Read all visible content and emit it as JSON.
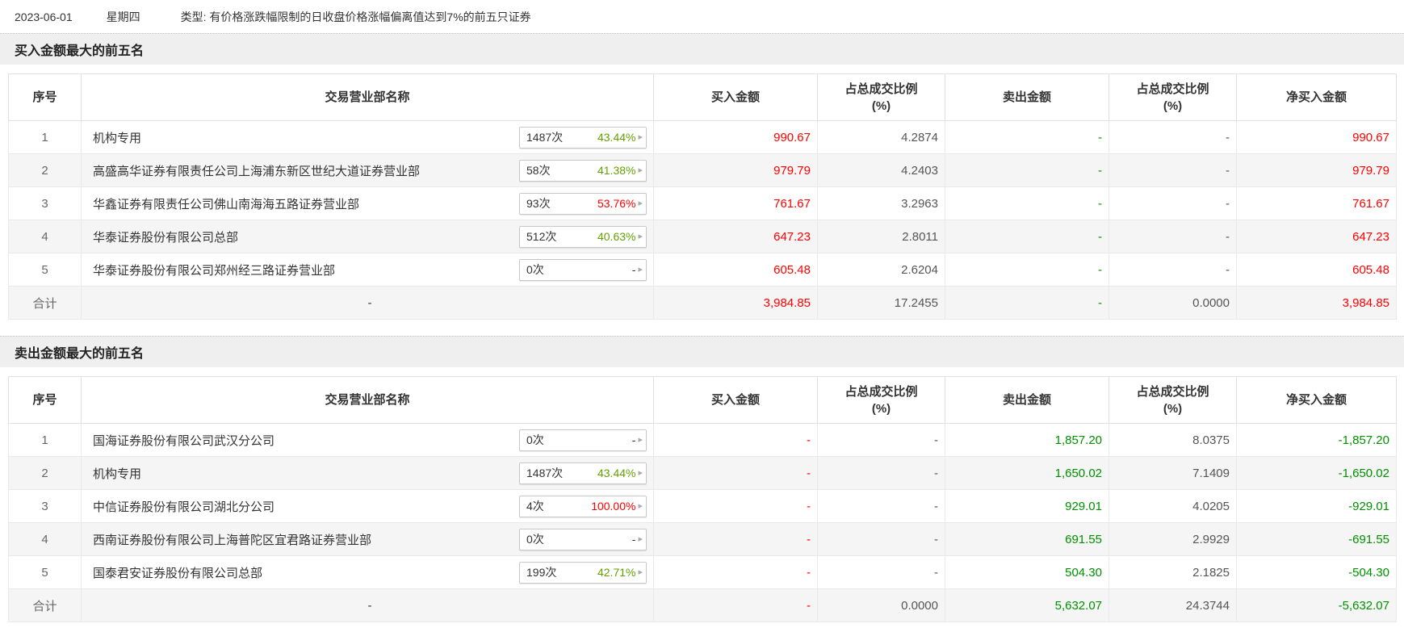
{
  "topbar": {
    "date": "2023-06-01",
    "weekday": "星期四",
    "type": "类型: 有价格涨跌幅限制的日收盘价格涨幅偏离值达到7%的前五只证券"
  },
  "colors": {
    "red": "#ff0000",
    "green": "#009000",
    "badge_green": "#63a103",
    "badge_red": "#ff0000",
    "pct": "#555555",
    "dark": "#333333"
  },
  "sections": [
    {
      "title": "买入金额最大的前五名",
      "columns": [
        {
          "label": "序号"
        },
        {
          "label": "交易营业部名称"
        },
        {
          "label": "买入金额"
        },
        {
          "label": "占总成交比例",
          "sub": "(%)"
        },
        {
          "label": "卖出金额"
        },
        {
          "label": "占总成交比例",
          "sub": "(%)"
        },
        {
          "label": "净买入金额"
        }
      ],
      "rows": [
        {
          "no": "1",
          "name": "机构专用",
          "badge": {
            "count": "1487次",
            "pct": "43.44%",
            "pct_color": "badge_green"
          },
          "buy": {
            "v": "990.67",
            "c": "red"
          },
          "buy_pct": {
            "v": "4.2874",
            "c": "pct"
          },
          "sell": {
            "v": "-",
            "c": "green"
          },
          "sell_pct": {
            "v": "-",
            "c": "pct"
          },
          "net": {
            "v": "990.67",
            "c": "red"
          }
        },
        {
          "no": "2",
          "name": "高盛高华证券有限责任公司上海浦东新区世纪大道证券营业部",
          "badge": {
            "count": "58次",
            "pct": "41.38%",
            "pct_color": "badge_green"
          },
          "buy": {
            "v": "979.79",
            "c": "red"
          },
          "buy_pct": {
            "v": "4.2403",
            "c": "pct"
          },
          "sell": {
            "v": "-",
            "c": "green"
          },
          "sell_pct": {
            "v": "-",
            "c": "pct"
          },
          "net": {
            "v": "979.79",
            "c": "red"
          }
        },
        {
          "no": "3",
          "name": "华鑫证券有限责任公司佛山南海海五路证券营业部",
          "badge": {
            "count": "93次",
            "pct": "53.76%",
            "pct_color": "badge_red"
          },
          "buy": {
            "v": "761.67",
            "c": "red"
          },
          "buy_pct": {
            "v": "3.2963",
            "c": "pct"
          },
          "sell": {
            "v": "-",
            "c": "green"
          },
          "sell_pct": {
            "v": "-",
            "c": "pct"
          },
          "net": {
            "v": "761.67",
            "c": "red"
          }
        },
        {
          "no": "4",
          "name": "华泰证券股份有限公司总部",
          "badge": {
            "count": "512次",
            "pct": "40.63%",
            "pct_color": "badge_green"
          },
          "buy": {
            "v": "647.23",
            "c": "red"
          },
          "buy_pct": {
            "v": "2.8011",
            "c": "pct"
          },
          "sell": {
            "v": "-",
            "c": "green"
          },
          "sell_pct": {
            "v": "-",
            "c": "pct"
          },
          "net": {
            "v": "647.23",
            "c": "red"
          }
        },
        {
          "no": "5",
          "name": "华泰证券股份有限公司郑州经三路证券营业部",
          "badge": {
            "count": "0次",
            "pct": "-",
            "pct_color": "dark"
          },
          "buy": {
            "v": "605.48",
            "c": "red"
          },
          "buy_pct": {
            "v": "2.6204",
            "c": "pct"
          },
          "sell": {
            "v": "-",
            "c": "green"
          },
          "sell_pct": {
            "v": "-",
            "c": "pct"
          },
          "net": {
            "v": "605.48",
            "c": "red"
          }
        }
      ],
      "total_row": {
        "no": "合计",
        "name": "-",
        "badge": null,
        "buy": {
          "v": "3,984.85",
          "c": "red"
        },
        "buy_pct": {
          "v": "17.2455",
          "c": "pct"
        },
        "sell": {
          "v": "-",
          "c": "green"
        },
        "sell_pct": {
          "v": "0.0000",
          "c": "pct"
        },
        "net": {
          "v": "3,984.85",
          "c": "red"
        }
      }
    },
    {
      "title": "卖出金额最大的前五名",
      "columns": [
        {
          "label": "序号"
        },
        {
          "label": "交易营业部名称"
        },
        {
          "label": "买入金额"
        },
        {
          "label": "占总成交比例",
          "sub": "(%)"
        },
        {
          "label": "卖出金额"
        },
        {
          "label": "占总成交比例",
          "sub": "(%)"
        },
        {
          "label": "净买入金额"
        }
      ],
      "rows": [
        {
          "no": "1",
          "name": "国海证券股份有限公司武汉分公司",
          "badge": {
            "count": "0次",
            "pct": "-",
            "pct_color": "dark"
          },
          "buy": {
            "v": "-",
            "c": "red"
          },
          "buy_pct": {
            "v": "-",
            "c": "pct"
          },
          "sell": {
            "v": "1,857.20",
            "c": "green"
          },
          "sell_pct": {
            "v": "8.0375",
            "c": "pct"
          },
          "net": {
            "v": "-1,857.20",
            "c": "green"
          }
        },
        {
          "no": "2",
          "name": "机构专用",
          "badge": {
            "count": "1487次",
            "pct": "43.44%",
            "pct_color": "badge_green"
          },
          "buy": {
            "v": "-",
            "c": "red"
          },
          "buy_pct": {
            "v": "-",
            "c": "pct"
          },
          "sell": {
            "v": "1,650.02",
            "c": "green"
          },
          "sell_pct": {
            "v": "7.1409",
            "c": "pct"
          },
          "net": {
            "v": "-1,650.02",
            "c": "green"
          }
        },
        {
          "no": "3",
          "name": "中信证券股份有限公司湖北分公司",
          "badge": {
            "count": "4次",
            "pct": "100.00%",
            "pct_color": "badge_red"
          },
          "buy": {
            "v": "-",
            "c": "red"
          },
          "buy_pct": {
            "v": "-",
            "c": "pct"
          },
          "sell": {
            "v": "929.01",
            "c": "green"
          },
          "sell_pct": {
            "v": "4.0205",
            "c": "pct"
          },
          "net": {
            "v": "-929.01",
            "c": "green"
          }
        },
        {
          "no": "4",
          "name": "西南证券股份有限公司上海普陀区宜君路证券营业部",
          "badge": {
            "count": "0次",
            "pct": "-",
            "pct_color": "dark"
          },
          "buy": {
            "v": "-",
            "c": "red"
          },
          "buy_pct": {
            "v": "-",
            "c": "pct"
          },
          "sell": {
            "v": "691.55",
            "c": "green"
          },
          "sell_pct": {
            "v": "2.9929",
            "c": "pct"
          },
          "net": {
            "v": "-691.55",
            "c": "green"
          }
        },
        {
          "no": "5",
          "name": "国泰君安证券股份有限公司总部",
          "badge": {
            "count": "199次",
            "pct": "42.71%",
            "pct_color": "badge_green"
          },
          "buy": {
            "v": "-",
            "c": "red"
          },
          "buy_pct": {
            "v": "-",
            "c": "pct"
          },
          "sell": {
            "v": "504.30",
            "c": "green"
          },
          "sell_pct": {
            "v": "2.1825",
            "c": "pct"
          },
          "net": {
            "v": "-504.30",
            "c": "green"
          }
        }
      ],
      "total_row": {
        "no": "合计",
        "name": "-",
        "badge": null,
        "buy": {
          "v": "-",
          "c": "red"
        },
        "buy_pct": {
          "v": "0.0000",
          "c": "pct"
        },
        "sell": {
          "v": "5,632.07",
          "c": "green"
        },
        "sell_pct": {
          "v": "24.3744",
          "c": "pct"
        },
        "net": {
          "v": "-5,632.07",
          "c": "green"
        }
      }
    }
  ],
  "icons": {
    "badge_arrow": "▸"
  }
}
